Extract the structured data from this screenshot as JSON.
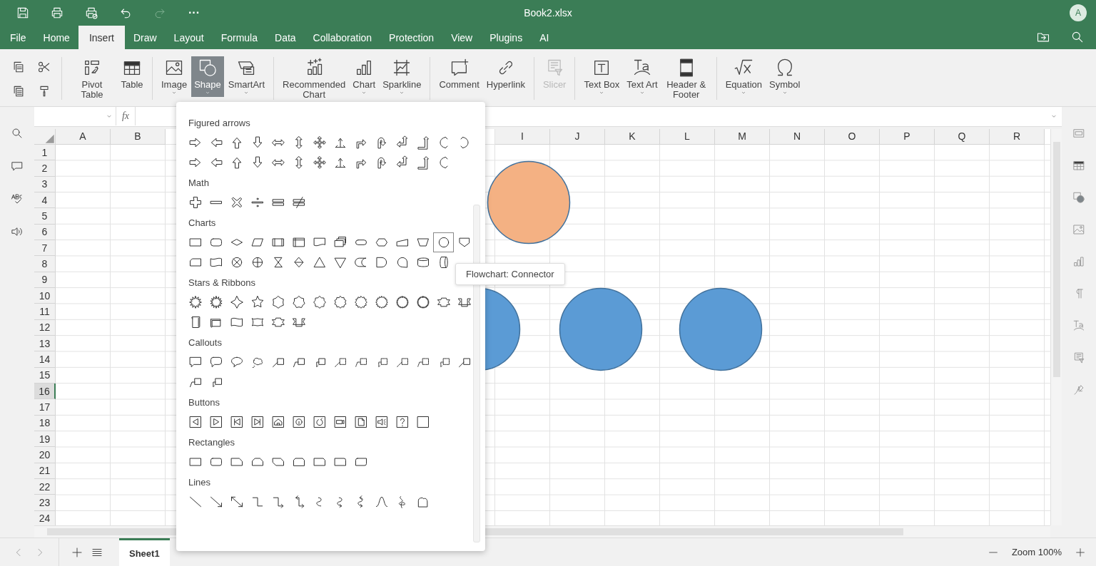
{
  "window": {
    "title": "Book2.xlsx",
    "avatar": "A",
    "quick_access": [
      {
        "kind": "save",
        "disabled": false
      },
      {
        "kind": "print",
        "disabled": false
      },
      {
        "kind": "quick-print",
        "disabled": false
      },
      {
        "kind": "undo",
        "disabled": false
      },
      {
        "kind": "redo",
        "disabled": true
      }
    ],
    "more": "···"
  },
  "menu_tabs": [
    {
      "label": "File",
      "selected": false
    },
    {
      "label": "Home",
      "selected": false
    },
    {
      "label": "Insert",
      "selected": true
    },
    {
      "label": "Draw",
      "selected": false
    },
    {
      "label": "Layout",
      "selected": false
    },
    {
      "label": "Formula",
      "selected": false
    },
    {
      "label": "Data",
      "selected": false
    },
    {
      "label": "Collaboration",
      "selected": false
    },
    {
      "label": "Protection",
      "selected": false
    },
    {
      "label": "View",
      "selected": false
    },
    {
      "label": "Plugins",
      "selected": false
    },
    {
      "label": "AI",
      "selected": false
    }
  ],
  "menu_actions": [
    {
      "kind": "open-folder"
    },
    {
      "kind": "search"
    }
  ],
  "toolbar": {
    "small_tools": [
      {
        "kind": "copy"
      },
      {
        "kind": "cut"
      },
      {
        "kind": "paste"
      },
      {
        "kind": "format-painter"
      }
    ],
    "groups": [
      [
        {
          "label": "Pivot Table",
          "kind": "pivot",
          "dropdown": false,
          "disabled": false,
          "selected": false
        },
        {
          "label": "Table",
          "kind": "table",
          "dropdown": false,
          "disabled": false,
          "selected": false
        }
      ],
      [
        {
          "label": "Image",
          "kind": "image",
          "dropdown": true,
          "disabled": false,
          "selected": false
        },
        {
          "label": "Shape",
          "kind": "shape",
          "dropdown": true,
          "disabled": false,
          "selected": true
        },
        {
          "label": "SmartArt",
          "kind": "smartart",
          "dropdown": true,
          "disabled": false,
          "selected": false
        }
      ],
      [
        {
          "label": "Recommended Chart",
          "kind": "recommended-chart",
          "dropdown": false,
          "disabled": false,
          "selected": false
        },
        {
          "label": "Chart",
          "kind": "chart",
          "dropdown": true,
          "disabled": false,
          "selected": false
        },
        {
          "label": "Sparkline",
          "kind": "sparkline",
          "dropdown": true,
          "disabled": false,
          "selected": false
        }
      ],
      [
        {
          "label": "Comment",
          "kind": "comment",
          "dropdown": false,
          "disabled": false,
          "selected": false
        },
        {
          "label": "Hyperlink",
          "kind": "hyperlink",
          "dropdown": false,
          "disabled": false,
          "selected": false
        }
      ],
      [
        {
          "label": "Slicer",
          "kind": "slicer",
          "dropdown": false,
          "disabled": true,
          "selected": false
        }
      ],
      [
        {
          "label": "Text Box",
          "kind": "textbox",
          "dropdown": true,
          "disabled": false,
          "selected": false
        },
        {
          "label": "Text Art",
          "kind": "textart",
          "dropdown": true,
          "disabled": false,
          "selected": false
        },
        {
          "label": "Header & Footer",
          "kind": "header-footer",
          "dropdown": false,
          "disabled": false,
          "selected": false
        }
      ],
      [
        {
          "label": "Equation",
          "kind": "equation",
          "dropdown": true,
          "disabled": false,
          "selected": false
        },
        {
          "label": "Symbol",
          "kind": "symbol",
          "dropdown": true,
          "disabled": false,
          "selected": false
        }
      ]
    ]
  },
  "formula_bar": {
    "fx": "fx"
  },
  "left_sidebar": [
    {
      "kind": "search"
    },
    {
      "kind": "comment"
    },
    {
      "kind": "spellcheck"
    },
    {
      "kind": "speaker"
    }
  ],
  "right_sidebar": [
    {
      "kind": "cell-settings"
    },
    {
      "kind": "table"
    },
    {
      "kind": "shape"
    },
    {
      "kind": "image"
    },
    {
      "kind": "chart"
    },
    {
      "kind": "paragraph"
    },
    {
      "kind": "textart"
    },
    {
      "kind": "slicer"
    },
    {
      "kind": "signature"
    }
  ],
  "sheet": {
    "columns": [
      {
        "label": "A",
        "selected": false
      },
      {
        "label": "B",
        "selected": false
      },
      {
        "label": "I",
        "selected": false
      },
      {
        "label": "J",
        "selected": false
      },
      {
        "label": "K",
        "selected": false
      },
      {
        "label": "L",
        "selected": false
      },
      {
        "label": "M",
        "selected": false
      },
      {
        "label": "N",
        "selected": false
      },
      {
        "label": "O",
        "selected": false
      },
      {
        "label": "P",
        "selected": false
      },
      {
        "label": "Q",
        "selected": false
      },
      {
        "label": "R",
        "selected": false
      }
    ],
    "rows": [
      {
        "label": "1",
        "selected": false
      },
      {
        "label": "2",
        "selected": false
      },
      {
        "label": "3",
        "selected": false
      },
      {
        "label": "4",
        "selected": false
      },
      {
        "label": "5",
        "selected": false
      },
      {
        "label": "6",
        "selected": false
      },
      {
        "label": "7",
        "selected": false
      },
      {
        "label": "8",
        "selected": false
      },
      {
        "label": "9",
        "selected": false
      },
      {
        "label": "10",
        "selected": false
      },
      {
        "label": "11",
        "selected": false
      },
      {
        "label": "12",
        "selected": false
      },
      {
        "label": "13",
        "selected": false
      },
      {
        "label": "14",
        "selected": false
      },
      {
        "label": "15",
        "selected": false
      },
      {
        "label": "16",
        "selected": true
      },
      {
        "label": "17",
        "selected": false
      },
      {
        "label": "18",
        "selected": false
      },
      {
        "label": "19",
        "selected": false
      },
      {
        "label": "20",
        "selected": false
      },
      {
        "label": "21",
        "selected": false
      },
      {
        "label": "22",
        "selected": false
      },
      {
        "label": "23",
        "selected": false
      },
      {
        "label": "24",
        "selected": false
      }
    ],
    "shapes": [
      {
        "kind": "circle",
        "color": "#f4b183"
      },
      {
        "kind": "circle",
        "color": "#5b9bd5"
      },
      {
        "kind": "circle",
        "color": "#5b9bd5"
      },
      {
        "kind": "circle",
        "color": "#5b9bd5"
      }
    ]
  },
  "shape_menu": {
    "tooltip": "Flowchart: Connector",
    "groups": [
      {
        "title": "Figured arrows",
        "kind": "arrows",
        "items": [
          {
            "selected": false
          },
          {
            "selected": false
          },
          {
            "selected": false
          },
          {
            "selected": false
          },
          {
            "selected": false
          },
          {
            "selected": false
          },
          {
            "selected": false
          },
          {
            "selected": false
          },
          {
            "selected": false
          },
          {
            "selected": false
          },
          {
            "selected": false
          },
          {
            "selected": false
          },
          {
            "selected": false
          },
          {
            "selected": false
          },
          {
            "selected": false
          },
          {
            "selected": false
          },
          {
            "selected": false
          },
          {
            "selected": false
          },
          {
            "selected": false
          },
          {
            "selected": false
          },
          {
            "selected": false
          },
          {
            "selected": false
          },
          {
            "selected": false
          },
          {
            "selected": false
          },
          {
            "selected": false
          },
          {
            "selected": false
          },
          {
            "selected": false
          }
        ]
      },
      {
        "title": "Math",
        "kind": "math",
        "items": [
          {
            "selected": false
          },
          {
            "selected": false
          },
          {
            "selected": false
          },
          {
            "selected": false
          },
          {
            "selected": false
          },
          {
            "selected": false
          }
        ]
      },
      {
        "title": "Charts",
        "kind": "flowchart",
        "items": [
          {
            "selected": false
          },
          {
            "selected": false
          },
          {
            "selected": false
          },
          {
            "selected": false
          },
          {
            "selected": false
          },
          {
            "selected": false
          },
          {
            "selected": false
          },
          {
            "selected": false
          },
          {
            "selected": false
          },
          {
            "selected": false
          },
          {
            "selected": false
          },
          {
            "selected": false
          },
          {
            "selected": true
          },
          {
            "selected": false
          },
          {
            "selected": false
          },
          {
            "selected": false
          },
          {
            "selected": false
          },
          {
            "selected": false
          },
          {
            "selected": false
          },
          {
            "selected": false
          },
          {
            "selected": false
          },
          {
            "selected": false
          },
          {
            "selected": false
          },
          {
            "selected": false
          },
          {
            "selected": false
          },
          {
            "selected": false
          },
          {
            "selected": false
          }
        ]
      },
      {
        "title": "Stars & Ribbons",
        "kind": "stars",
        "items": [
          {
            "selected": false
          },
          {
            "selected": false
          },
          {
            "selected": false
          },
          {
            "selected": false
          },
          {
            "selected": false
          },
          {
            "selected": false
          },
          {
            "selected": false
          },
          {
            "selected": false
          },
          {
            "selected": false
          },
          {
            "selected": false
          },
          {
            "selected": false
          },
          {
            "selected": false
          },
          {
            "selected": false
          },
          {
            "selected": false
          },
          {
            "selected": false
          },
          {
            "selected": false
          },
          {
            "selected": false
          },
          {
            "selected": false
          },
          {
            "selected": false
          },
          {
            "selected": false
          }
        ]
      },
      {
        "title": "Callouts",
        "kind": "callouts",
        "items": [
          {
            "selected": false
          },
          {
            "selected": false
          },
          {
            "selected": false
          },
          {
            "selected": false
          },
          {
            "selected": false
          },
          {
            "selected": false
          },
          {
            "selected": false
          },
          {
            "selected": false
          },
          {
            "selected": false
          },
          {
            "selected": false
          },
          {
            "selected": false
          },
          {
            "selected": false
          },
          {
            "selected": false
          },
          {
            "selected": false
          },
          {
            "selected": false
          },
          {
            "selected": false
          }
        ]
      },
      {
        "title": "Buttons",
        "kind": "buttons",
        "items": [
          {
            "selected": false
          },
          {
            "selected": false
          },
          {
            "selected": false
          },
          {
            "selected": false
          },
          {
            "selected": false
          },
          {
            "selected": false
          },
          {
            "selected": false
          },
          {
            "selected": false
          },
          {
            "selected": false
          },
          {
            "selected": false
          },
          {
            "selected": false
          },
          {
            "selected": false
          }
        ]
      },
      {
        "title": "Rectangles",
        "kind": "rectangles",
        "items": [
          {
            "selected": false
          },
          {
            "selected": false
          },
          {
            "selected": false
          },
          {
            "selected": false
          },
          {
            "selected": false
          },
          {
            "selected": false
          },
          {
            "selected": false
          },
          {
            "selected": false
          },
          {
            "selected": false
          }
        ]
      },
      {
        "title": "Lines",
        "kind": "lines",
        "items": [
          {
            "selected": false
          },
          {
            "selected": false
          },
          {
            "selected": false
          },
          {
            "selected": false
          },
          {
            "selected": false
          },
          {
            "selected": false
          },
          {
            "selected": false
          },
          {
            "selected": false
          },
          {
            "selected": false
          },
          {
            "selected": false
          },
          {
            "selected": false
          },
          {
            "selected": false
          }
        ]
      }
    ]
  },
  "sheet_tabs": [
    {
      "label": "Sheet1",
      "selected": true
    }
  ],
  "zoom": {
    "label": "Zoom 100%"
  }
}
